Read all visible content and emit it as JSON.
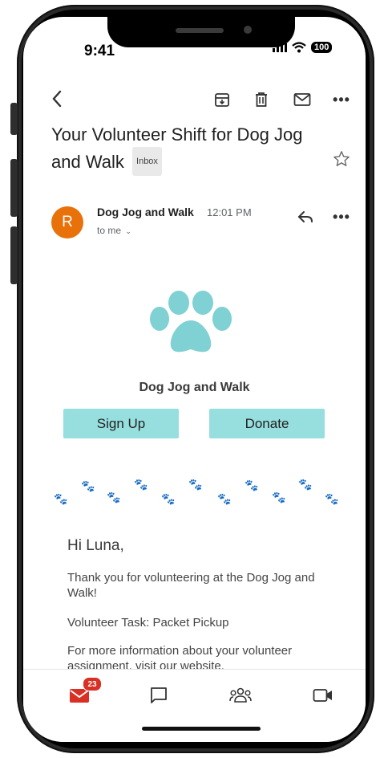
{
  "status_bar": {
    "time": "9:41",
    "battery": "100"
  },
  "toolbar": {
    "back_icon": "back-arrow-icon",
    "archive_icon": "archive-icon",
    "delete_icon": "trash-icon",
    "mark_unread_icon": "mail-icon",
    "more_icon": "more-horizontal-icon"
  },
  "email": {
    "subject": "Your Volunteer Shift for Dog Jog and Walk",
    "label": "Inbox",
    "sender_initial": "R",
    "sender_name": "Dog Jog and Walk",
    "time": "12:01 PM",
    "recipient": "to me",
    "avatar_color": "#e8710a"
  },
  "body": {
    "org_name": "Dog Jog and Walk",
    "signup_label": "Sign Up",
    "donate_label": "Donate",
    "button_color": "#96dfde",
    "paw_color": "#7fd1d3",
    "pawprint_color": "#e04fa4",
    "greeting": "Hi Luna,",
    "paragraphs": [
      "Thank you for volunteering at the Dog Jog and Walk!",
      "Volunteer Task: Packet Pickup",
      "For more information about your volunteer assignment, visit our website."
    ]
  },
  "bottom_nav": {
    "items": [
      "mail-icon",
      "chat-icon",
      "spaces-icon",
      "meet-icon"
    ],
    "mail_badge": "23"
  }
}
